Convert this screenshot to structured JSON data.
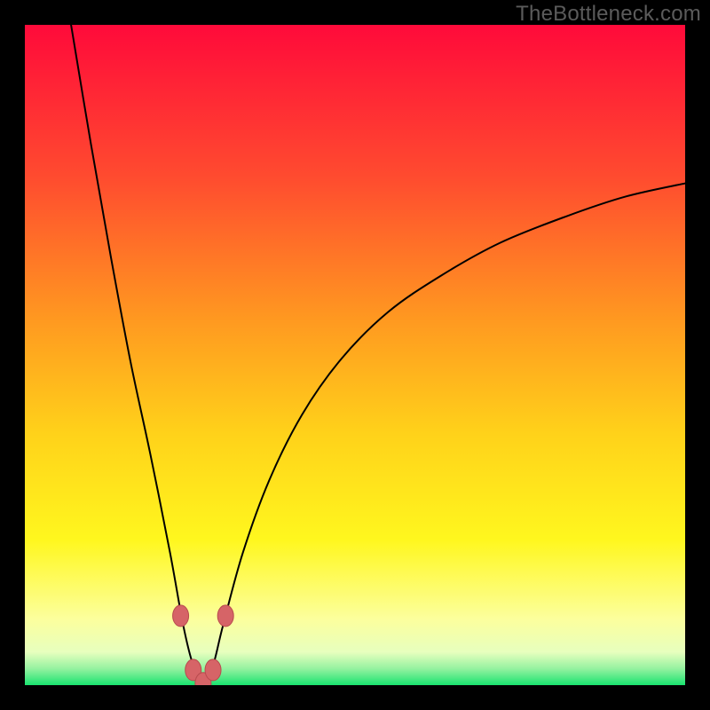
{
  "watermark": "TheBottleneck.com",
  "colors": {
    "page_bg": "#000000",
    "gradient_stops": [
      {
        "offset": 0.0,
        "color": "#ff0a3a"
      },
      {
        "offset": 0.23,
        "color": "#ff4b2f"
      },
      {
        "offset": 0.45,
        "color": "#ff9a20"
      },
      {
        "offset": 0.62,
        "color": "#ffd21a"
      },
      {
        "offset": 0.78,
        "color": "#fff71e"
      },
      {
        "offset": 0.9,
        "color": "#fcff9d"
      },
      {
        "offset": 0.95,
        "color": "#e7ffbe"
      },
      {
        "offset": 0.975,
        "color": "#95f2a0"
      },
      {
        "offset": 1.0,
        "color": "#19e36f"
      }
    ],
    "curve": "#000000",
    "marker_fill": "#d66467",
    "marker_stroke": "#b84b4e"
  },
  "chart_data": {
    "type": "line",
    "title": "",
    "xlabel": "",
    "ylabel": "",
    "xlim": [
      0,
      100
    ],
    "ylim": [
      0,
      100
    ],
    "grid": false,
    "legend": false,
    "note": "V-shaped curve; values read from pixel positions, minimum near x≈27, y≈0. Left branch rises steeply to y≈100 at x≈7; right branch rises with decreasing slope to y≈76 at x=100.",
    "series": [
      {
        "name": "curve",
        "x": [
          7.0,
          10.0,
          13.0,
          16.0,
          19.0,
          22.0,
          24.0,
          25.5,
          27.0,
          28.5,
          30.0,
          33.0,
          37.0,
          42.0,
          48.0,
          55.0,
          63.0,
          72.0,
          82.0,
          91.0,
          100.0
        ],
        "y": [
          100.0,
          82.0,
          65.0,
          49.0,
          35.0,
          20.0,
          9.0,
          3.0,
          0.3,
          3.0,
          9.0,
          20.0,
          31.0,
          41.0,
          49.5,
          56.5,
          62.0,
          67.0,
          71.0,
          74.0,
          76.0
        ]
      }
    ],
    "markers": {
      "name": "highlight-points",
      "x": [
        23.6,
        25.5,
        27.0,
        28.5,
        30.4
      ],
      "y": [
        10.5,
        2.3,
        0.3,
        2.3,
        10.5
      ]
    }
  }
}
